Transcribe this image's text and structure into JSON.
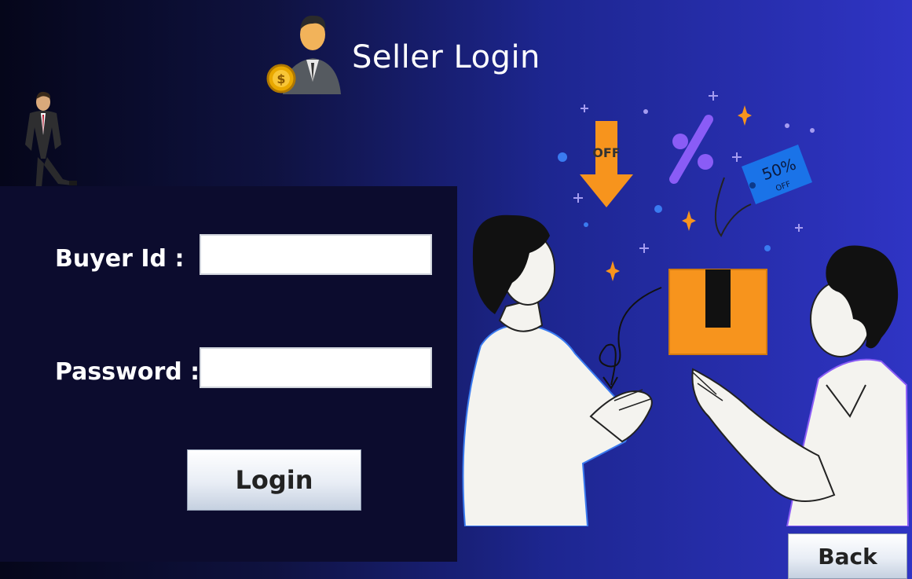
{
  "header": {
    "title": "Seller Login"
  },
  "form": {
    "buyer_id_label": "Buyer Id :",
    "buyer_id_value": "",
    "password_label": "Password :",
    "password_value": "",
    "login_label": "Login"
  },
  "footer": {
    "back_label": "Back"
  },
  "illustration": {
    "off_tag": "OFF",
    "discount_text": "50%",
    "discount_sub": "OFF"
  },
  "colors": {
    "accent_orange": "#f7941d",
    "accent_purple": "#8a5cf6",
    "tag_blue": "#1a73e8"
  }
}
